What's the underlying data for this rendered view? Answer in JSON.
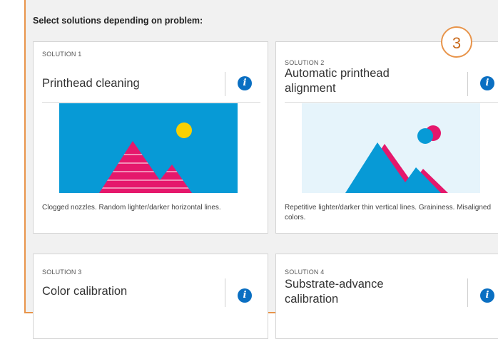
{
  "prompt": "Select solutions depending on problem:",
  "callout": "3",
  "accent_color": "#e8944a",
  "info_color": "#0a6fc2",
  "solutions": [
    {
      "label": "SOLUTION 1",
      "title": "Printhead cleaning",
      "description": "Clogged nozzles. Random lighter/darker horizontal lines.",
      "icon": "info-icon"
    },
    {
      "label": "SOLUTION 2",
      "title": "Automatic printhead alignment",
      "description": "Repetitive lighter/darker thin vertical lines. Graininess. Misaligned colors.",
      "icon": "info-icon"
    },
    {
      "label": "SOLUTION 3",
      "title": "Color calibration",
      "description": "",
      "icon": "info-icon"
    },
    {
      "label": "SOLUTION 4",
      "title": "Substrate-advance calibration",
      "description": "",
      "icon": "info-icon"
    }
  ]
}
